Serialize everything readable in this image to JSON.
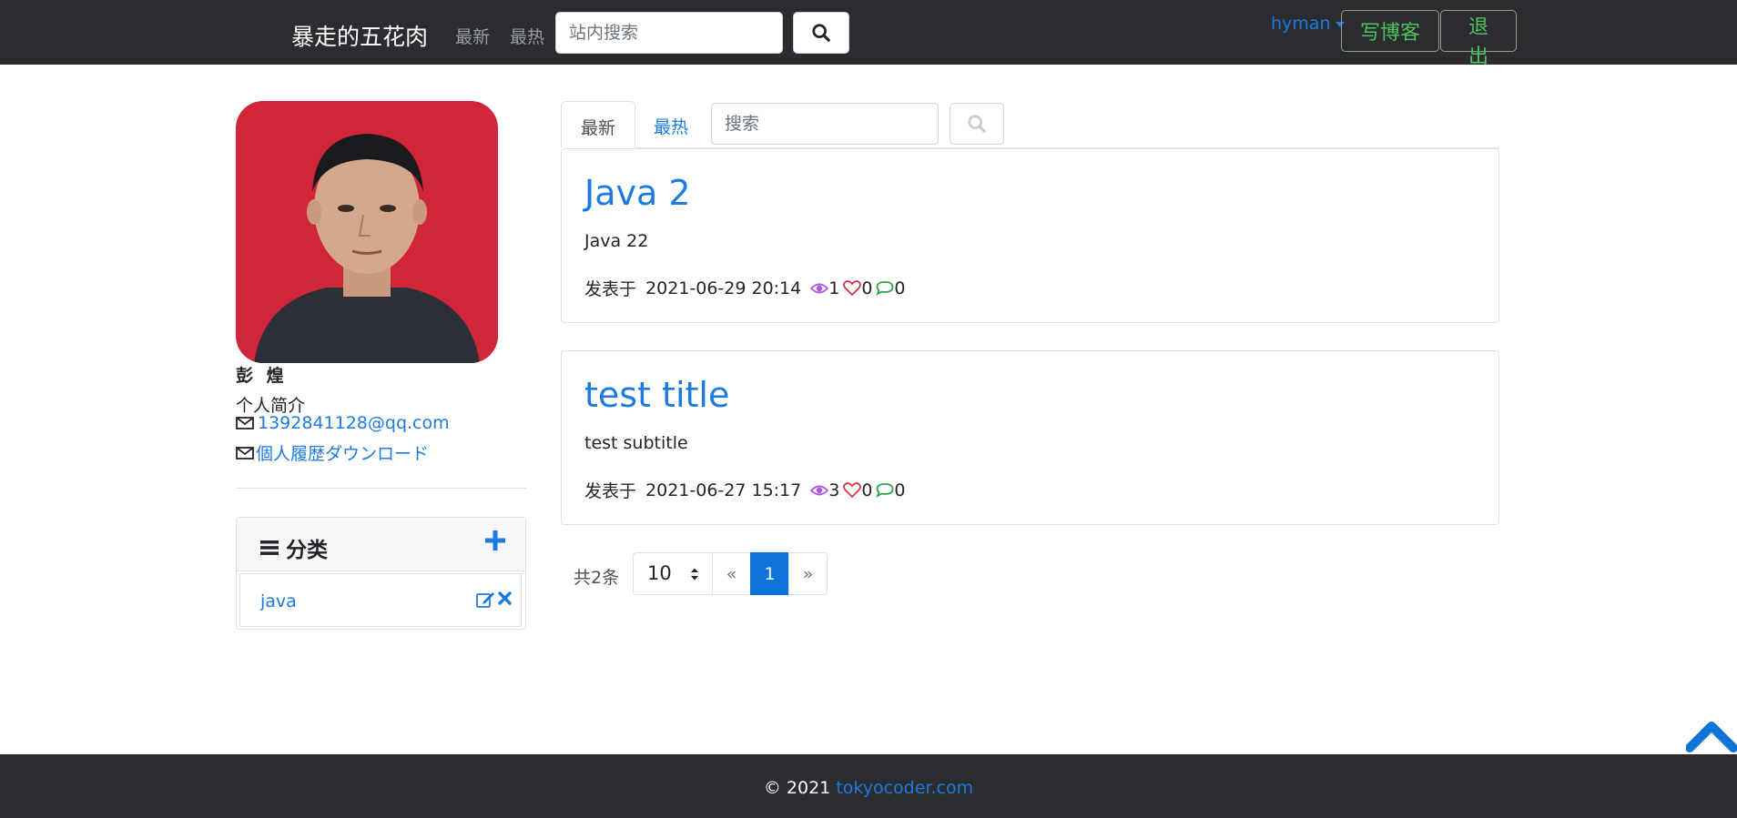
{
  "navbar": {
    "brand": "暴走的五花肉",
    "links": [
      "最新",
      "最热"
    ],
    "search_placeholder": "站内搜索",
    "user": "hyman",
    "write_label": "写博客",
    "logout_label": "退出"
  },
  "profile": {
    "name": "彭 煌",
    "intro_label": "个人简介",
    "email": "1392841128@qq.com",
    "resume_link": "個人履歴ダウンロード"
  },
  "categories": {
    "title": "分类",
    "items": [
      {
        "label": "java"
      }
    ]
  },
  "main": {
    "tabs": [
      "最新",
      "最热"
    ],
    "search_placeholder": "搜索",
    "posts": [
      {
        "title": "Java 2",
        "subtitle": "Java 22",
        "meta_prefix": "发表于",
        "date": "2021-06-29 20:14",
        "views": "1",
        "likes": "0",
        "comments": "0"
      },
      {
        "title": "test title",
        "subtitle": "test subtitle",
        "meta_prefix": "发表于",
        "date": "2021-06-27 15:17",
        "views": "3",
        "likes": "0",
        "comments": "0"
      }
    ]
  },
  "pagination": {
    "total": "共2条",
    "page_size": "10",
    "prev": "«",
    "current": "1",
    "next": "»"
  },
  "footer": {
    "copyright": "© 2021",
    "link": "tokyocoder.com"
  },
  "colors": {
    "accent": "#1b7be0",
    "navbar_bg": "#2b2c2f",
    "success": "#4fc15f",
    "view_icon": "#b056e0",
    "like_icon": "#dc3545",
    "comment_icon": "#28a745"
  }
}
